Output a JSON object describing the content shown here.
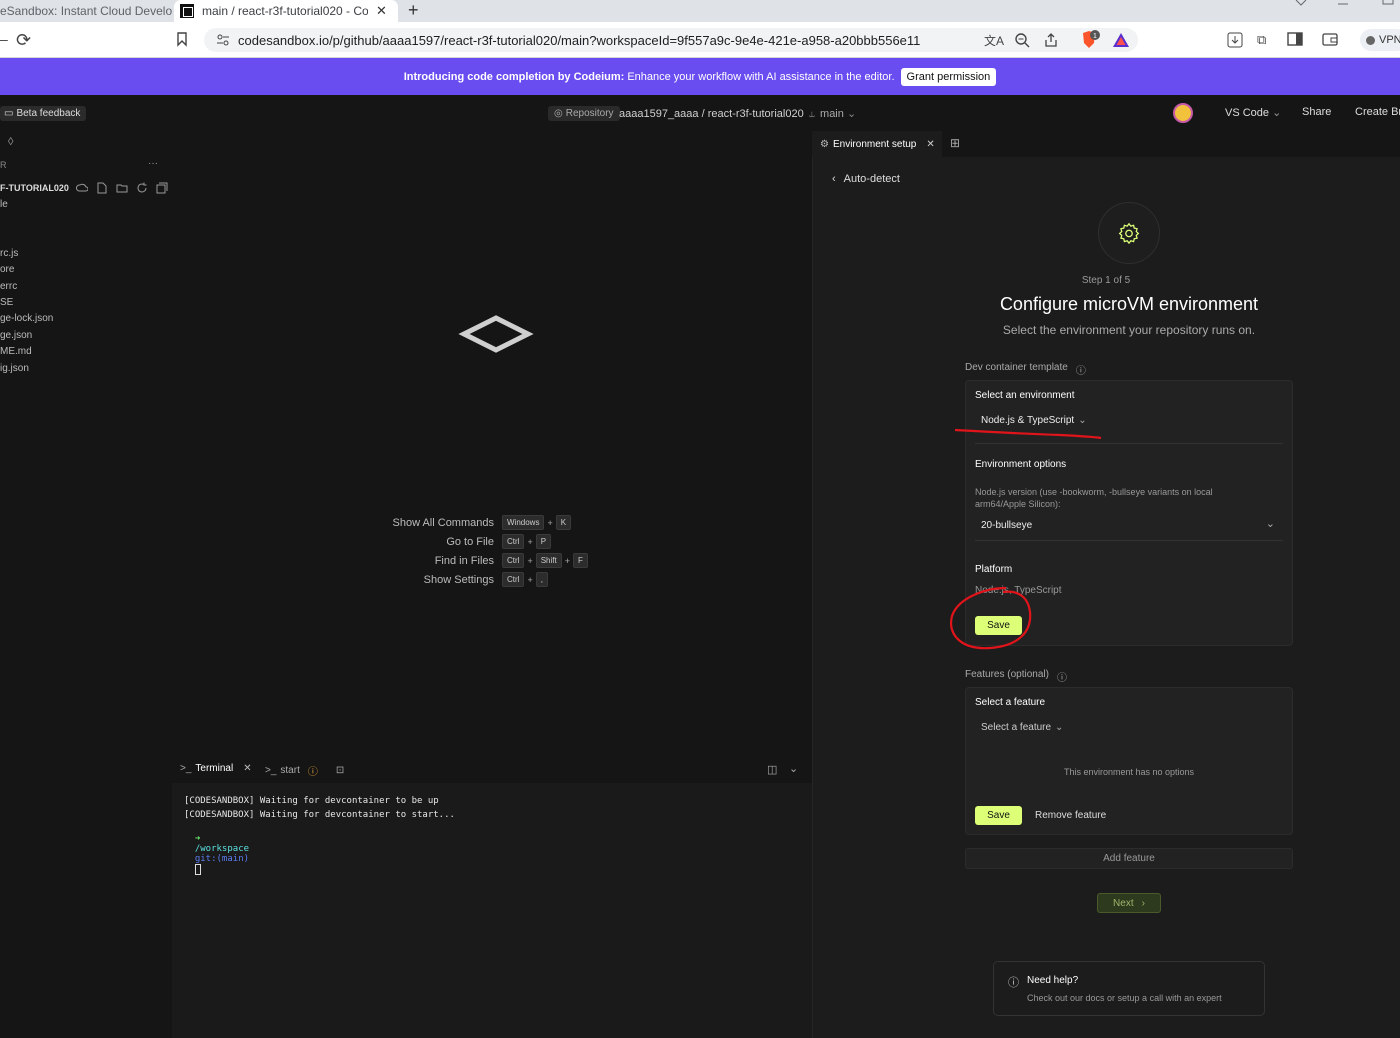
{
  "browser": {
    "tab1_title": "eSandbox: Instant Cloud Develop",
    "tab2_title": "main / react-r3f-tutorial020 - Co",
    "url": "codesandbox.io/p/github/aaaa1597/react-r3f-tutorial020/main?workspaceId=9f557a9c-9e4e-421e-a958-a20bbb556e11",
    "vpn_label": "VPN",
    "brave_badge": "1"
  },
  "banner": {
    "lead": "Introducing code completion by Codeium:",
    "text": "Enhance your workflow with AI assistance in the editor.",
    "button": "Grant permission"
  },
  "header": {
    "beta_feedback": "Beta feedback",
    "repo_badge": "Repository",
    "repo_path": "aaaa1597_aaaa / react-r3f-tutorial020",
    "branch": "main",
    "editor_menu": "VS Code",
    "share": "Share",
    "create_branch": "Create Br"
  },
  "sidebar": {
    "section": "R",
    "more": "···",
    "root": "F-TUTORIAL020",
    "files": [
      "le",
      "rc.js",
      "ore",
      "errc",
      "SE",
      "ge-lock.json",
      "ge.json",
      "ME.md",
      "ig.json"
    ]
  },
  "editor": {
    "commands": [
      {
        "label": "Show All Commands",
        "keys": [
          "Windows",
          "K"
        ]
      },
      {
        "label": "Go to File",
        "keys": [
          "Ctrl",
          "P"
        ]
      },
      {
        "label": "Find in Files",
        "keys": [
          "Ctrl",
          "Shift",
          "F"
        ]
      },
      {
        "label": "Show Settings",
        "keys": [
          "Ctrl",
          ","
        ]
      }
    ]
  },
  "terminal": {
    "tab_terminal": "Terminal",
    "tab_start": "start",
    "lines": [
      "[CODESANDBOX] Waiting for devcontainer to be up",
      "[CODESANDBOX] Waiting for devcontainer to start..."
    ],
    "prompt_arrow": "➜",
    "prompt_dir": "/workspace",
    "prompt_git": "git:(main)"
  },
  "panel": {
    "tab_label": "Environment setup",
    "back_label": "Auto-detect",
    "step": "Step 1 of 5",
    "title": "Configure microVM environment",
    "subtitle": "Select the environment your repository runs on.",
    "dev_container_label": "Dev container template",
    "select_env_label": "Select an environment",
    "env_value": "Node.js & TypeScript",
    "env_options_label": "Environment options",
    "node_version_desc": "Node.js version (use -bookworm, -bullseye variants on local arm64/Apple Silicon):",
    "node_version_value": "20-bullseye",
    "platform_label": "Platform",
    "platform_value": "Node.js, TypeScript",
    "save1": "Save",
    "features_label": "Features (optional)",
    "select_feature_label": "Select a feature",
    "feature_value": "Select a feature",
    "no_options": "This environment has no options",
    "save2": "Save",
    "remove_feature": "Remove feature",
    "add_feature": "Add feature",
    "next": "Next",
    "help_title": "Need help?",
    "help_text": "Check out our docs or setup a call with an expert"
  },
  "colors": {
    "accent": "#dcff77",
    "banner": "#6a4df0",
    "annotation": "#e0141a"
  }
}
